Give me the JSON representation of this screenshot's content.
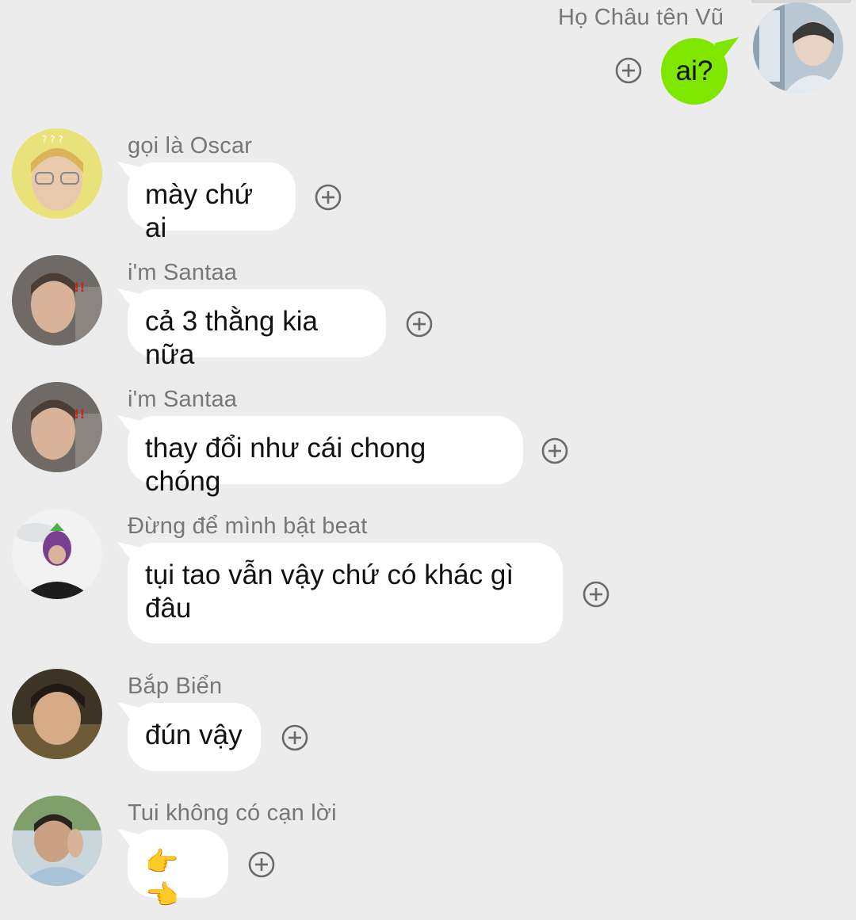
{
  "messages": [
    {
      "id": "m0",
      "sender": "Họ Châu tên Vũ",
      "text": "ai?",
      "outgoing": true,
      "avatar_icon": "user-photo-avatar"
    },
    {
      "id": "m1",
      "sender": "gọi là Oscar",
      "text": "mày chứ ai",
      "outgoing": false,
      "avatar_icon": "user-photo-avatar"
    },
    {
      "id": "m2",
      "sender": "i'm Santaa",
      "text": "cả 3 thằng kia nữa",
      "outgoing": false,
      "avatar_icon": "user-photo-avatar"
    },
    {
      "id": "m3",
      "sender": "i'm Santaa",
      "text": "thay đổi như cái chong chóng",
      "outgoing": false,
      "avatar_icon": "user-photo-avatar"
    },
    {
      "id": "m4",
      "sender": "Đừng để mình bật beat",
      "text": "tụi tao vẫn vậy chứ có khác gì đâu",
      "outgoing": false,
      "avatar_icon": "user-photo-avatar"
    },
    {
      "id": "m5",
      "sender": "Bắp Biển",
      "text": "đún vậy",
      "outgoing": false,
      "avatar_icon": "user-photo-avatar"
    },
    {
      "id": "m6",
      "sender": "Tui không có cạn lời",
      "text": "👉👈",
      "outgoing": false,
      "avatar_icon": "user-photo-avatar"
    }
  ],
  "reaction_icon": "add-reaction-icon",
  "colors": {
    "background": "#ececec",
    "outgoing_bubble": "#7fe600",
    "incoming_bubble": "#ffffff",
    "sender_name": "#777777"
  }
}
